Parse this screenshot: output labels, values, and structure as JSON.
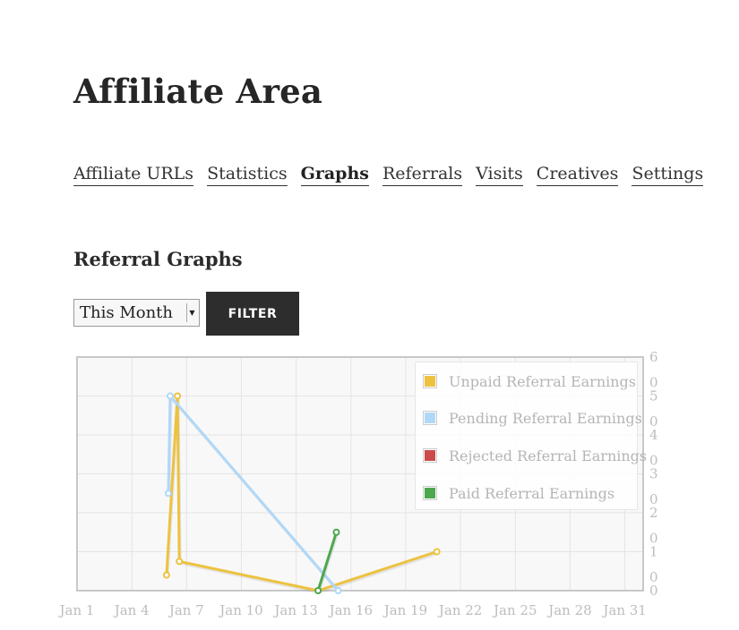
{
  "page": {
    "title": "Affiliate Area"
  },
  "tabs": [
    {
      "label": "Affiliate URLs",
      "active": false
    },
    {
      "label": "Statistics",
      "active": false
    },
    {
      "label": "Graphs",
      "active": true
    },
    {
      "label": "Referrals",
      "active": false
    },
    {
      "label": "Visits",
      "active": false
    },
    {
      "label": "Creatives",
      "active": false
    },
    {
      "label": "Settings",
      "active": false
    }
  ],
  "section": {
    "title": "Referral Graphs"
  },
  "filter": {
    "selected": "This Month",
    "button_label": "FILTER"
  },
  "chart_data": {
    "type": "line",
    "xlim": [
      1,
      32
    ],
    "x_ticks": [
      1,
      4,
      7,
      10,
      13,
      16,
      19,
      22,
      25,
      28,
      31
    ],
    "x_tick_labels": [
      "Jan 1",
      "Jan 4",
      "Jan 7",
      "Jan 10",
      "Jan 13",
      "Jan 16",
      "Jan 19",
      "Jan 22",
      "Jan 25",
      "Jan 28",
      "Jan 31"
    ],
    "ylim": [
      0,
      6
    ],
    "y_ticks": [
      0,
      1,
      2,
      3,
      4,
      5,
      6
    ],
    "y_tick_labels": [
      {
        "value": 0,
        "lines": [
          "0",
          "0"
        ]
      },
      {
        "value": 1,
        "lines": [
          "0",
          "1"
        ]
      },
      {
        "value": 2,
        "lines": [
          "0",
          "2"
        ]
      },
      {
        "value": 3,
        "lines": [
          "0",
          "3"
        ]
      },
      {
        "value": 4,
        "lines": [
          "0",
          "4"
        ]
      },
      {
        "value": 5,
        "lines": [
          "0",
          "5"
        ]
      },
      {
        "value": 6,
        "lines": [
          "6"
        ]
      }
    ],
    "grid": true,
    "legend_position": "top-right",
    "series": [
      {
        "name": "Unpaid Referral Earnings",
        "color": "#edc240",
        "points": [
          [
            5.9,
            0.4
          ],
          [
            6.5,
            5.0
          ],
          [
            6.6,
            0.75
          ],
          [
            14.2,
            0.0
          ],
          [
            20.7,
            1.0
          ]
        ]
      },
      {
        "name": "Pending Referral Earnings",
        "color": "#afd8f8",
        "points": [
          [
            6.0,
            2.5
          ],
          [
            6.1,
            5.0
          ],
          [
            15.3,
            0.0
          ]
        ]
      },
      {
        "name": "Rejected Referral Earnings",
        "color": "#cb4b4b",
        "points": []
      },
      {
        "name": "Paid Referral Earnings",
        "color": "#4da74d",
        "points": [
          [
            14.2,
            0.0
          ],
          [
            15.2,
            1.5
          ]
        ]
      }
    ]
  }
}
